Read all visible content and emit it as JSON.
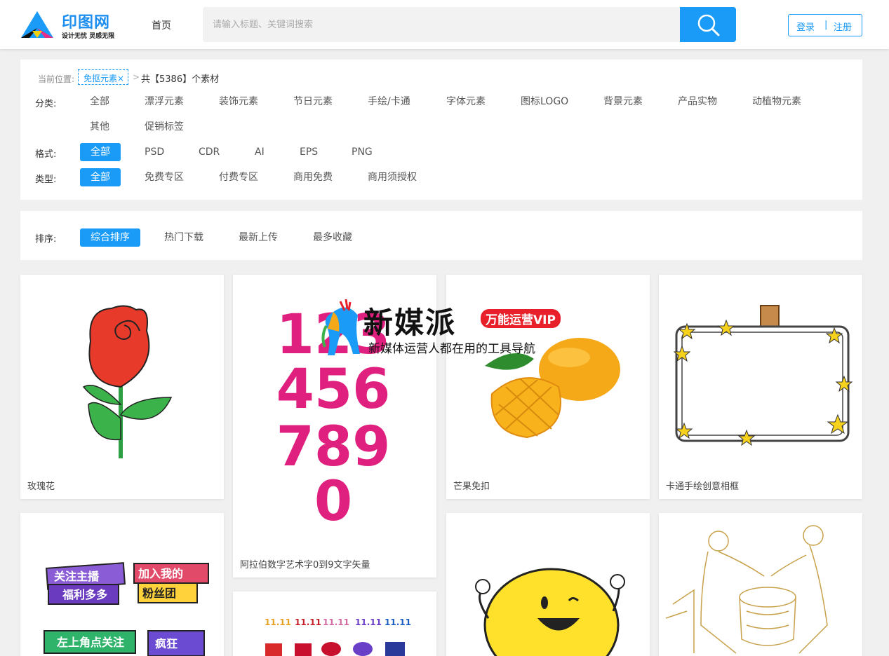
{
  "header": {
    "logo_name": "印图网",
    "logo_slogan": "设计无忧 灵感无限",
    "nav_home": "首页",
    "search_placeholder": "请输入标题、关键词搜索",
    "login": "登录",
    "divider": "|",
    "register": "注册"
  },
  "breadcrumb": {
    "label": "当前位置:",
    "tag": "免抠元素×",
    "sep": ">",
    "count": "共【5386】个素材"
  },
  "filters": {
    "category": {
      "label": "分类:",
      "options": [
        "全部",
        "漂浮元素",
        "装饰元素",
        "节日元素",
        "手绘/卡通",
        "字体元素",
        "图标LOGO",
        "背景元素",
        "产品实物",
        "动植物元素",
        "其他",
        "促销标签"
      ]
    },
    "format": {
      "label": "格式:",
      "options": [
        "全部",
        "PSD",
        "CDR",
        "AI",
        "EPS",
        "PNG"
      ],
      "selected": "全部"
    },
    "type": {
      "label": "类型:",
      "options": [
        "全部",
        "免费专区",
        "付费专区",
        "商用免费",
        "商用须授权"
      ],
      "selected": "全部"
    }
  },
  "sort": {
    "label": "排序:",
    "options": [
      "综合排序",
      "热门下载",
      "最新上传",
      "最多收藏"
    ],
    "selected": "综合排序"
  },
  "cards": [
    {
      "title": "玫瑰花"
    },
    {
      "title": "阿拉伯数字艺术字0到9文字矢量"
    },
    {
      "title": "芒果免扣"
    },
    {
      "title": "卡通手绘创意相框"
    }
  ],
  "card_art_text": {
    "digits_row1": "123",
    "digits_row2": "456",
    "digits_row3": "789",
    "digits_row4": "0",
    "sticker1": "关注主播",
    "sticker2": "福利多多",
    "sticker3": "加入我的",
    "sticker4": "粉丝团",
    "sticker5": "左上角点关注",
    "sticker6": "疯狂",
    "badge": "11.11"
  },
  "ad": {
    "title": "新媒派",
    "badge": "万能运营VIP",
    "subtitle": "新媒体运营人都在用的工具导航"
  },
  "colors": {
    "accent": "#1a9bf8",
    "ad_badge": "#e8202a"
  }
}
